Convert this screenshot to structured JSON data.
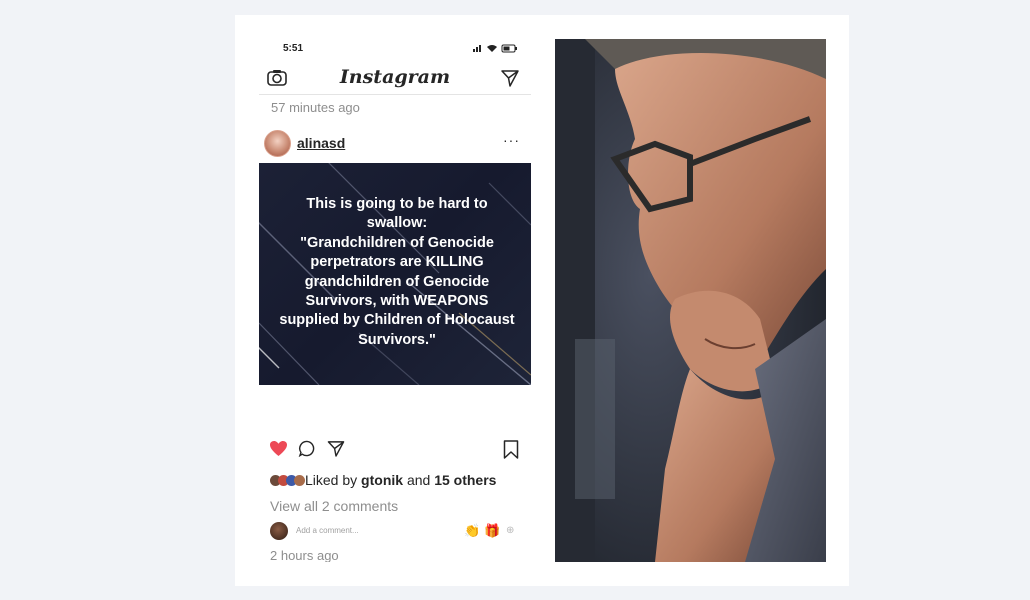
{
  "status_bar": {
    "time": "5:51",
    "indicators": "signal wifi battery"
  },
  "header": {
    "logo": "Instagram",
    "camera_icon": "camera-icon",
    "direct_icon": "paper-plane-icon"
  },
  "previous_post_time": "57 minutes ago",
  "post": {
    "username": "alinasd",
    "more": "···",
    "image_text": "This is going to be hard to\nswallow:\n\"Grandchildren of Genocide\nperpetrators are KILLING\ngrandchildren of Genocide\nSurvivors, with WEAPONS\nsupplied by Children of Holocaust\nSurvivors.\"",
    "liked_by_prefix": "Liked by",
    "liked_by_user": "gtonik",
    "liked_by_and": "and",
    "liked_by_others": "15 others",
    "view_comments": "View all 2 comments",
    "add_comment_placeholder": "Add a comment...",
    "emoji_1": "👏",
    "emoji_2": "🎁",
    "emoji_3": "⊕",
    "time": "2 hours ago"
  },
  "colors": {
    "like": "#ed4956",
    "background": "#f1f3f7",
    "post_bg": "#1a1e33"
  },
  "icons": [
    "camera-icon",
    "paper-plane-icon",
    "heart-icon",
    "comment-icon",
    "share-icon",
    "bookmark-icon"
  ]
}
